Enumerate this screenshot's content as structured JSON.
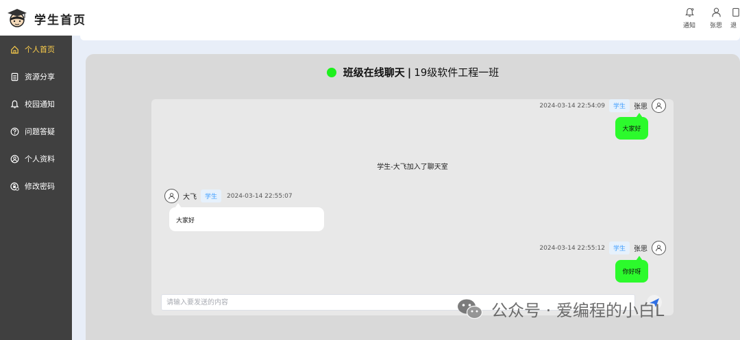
{
  "header": {
    "title": "学生首页",
    "actions": [
      {
        "label": "通知",
        "icon": "bell-icon"
      },
      {
        "label": "张思",
        "icon": "user-icon"
      },
      {
        "label": "退",
        "icon": "logout-icon"
      }
    ]
  },
  "sidebar": {
    "items": [
      {
        "label": "个人首页",
        "icon": "home-icon",
        "active": true
      },
      {
        "label": "资源分享",
        "icon": "document-icon",
        "active": false
      },
      {
        "label": "校园通知",
        "icon": "bell-icon",
        "active": false
      },
      {
        "label": "问题答疑",
        "icon": "question-icon",
        "active": false
      },
      {
        "label": "个人资料",
        "icon": "user-circle-icon",
        "active": false
      },
      {
        "label": "修改密码",
        "icon": "lock-icon",
        "active": false
      }
    ]
  },
  "chat": {
    "room_name": "班级在线聊天",
    "separator": "|",
    "class_name": "19级软件工程一班",
    "status_color": "#1df01d",
    "messages": [
      {
        "type": "self",
        "time": "2024-03-14 22:54:09",
        "tag": "学生",
        "sender": "张思",
        "text": "大家好"
      },
      {
        "type": "system",
        "text": "学生-大飞加入了聊天室"
      },
      {
        "type": "other",
        "sender": "大飞",
        "tag": "学生",
        "time": "2024-03-14 22:55:07",
        "text": "大家好"
      },
      {
        "type": "self",
        "time": "2024-03-14 22:55:12",
        "tag": "学生",
        "sender": "张思",
        "text": "你好呀"
      }
    ],
    "input_placeholder": "请输入要发送的内容"
  },
  "watermark": {
    "text": "公众号 · 爱编程的小白L",
    "icon": "wechat-icon"
  },
  "colors": {
    "sidebar_bg": "#404040",
    "active_nav": "#ffd04b",
    "self_bubble": "#2cfa2c",
    "tag_text": "#409eff"
  }
}
